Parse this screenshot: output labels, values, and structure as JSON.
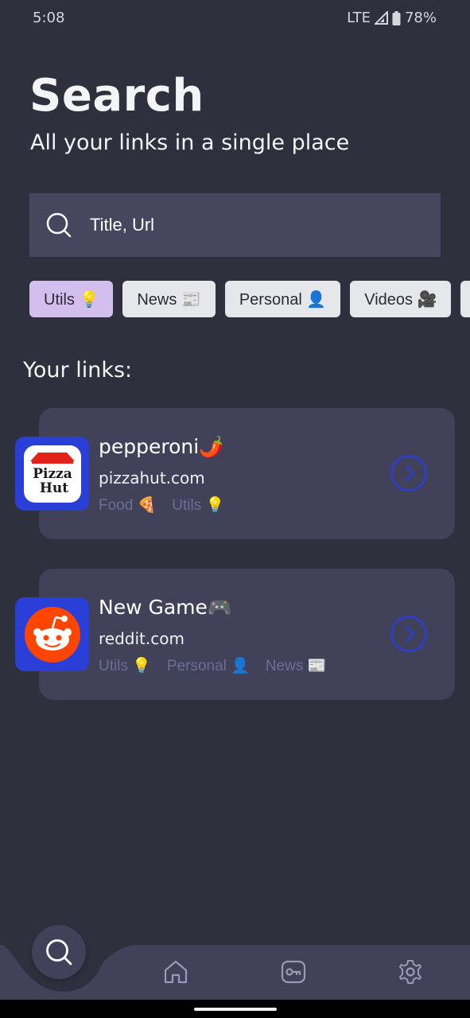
{
  "status_bar": {
    "time": "5:08",
    "network": "LTE",
    "battery": "78%"
  },
  "header": {
    "title": "Search",
    "subtitle": "All your links in a single place"
  },
  "search": {
    "placeholder": "Title, Url",
    "icon": "search-icon"
  },
  "chips": [
    {
      "label": "Utils 💡",
      "selected": true
    },
    {
      "label": "News 📰",
      "selected": false
    },
    {
      "label": "Personal 👤",
      "selected": false
    },
    {
      "label": "Videos 🎥",
      "selected": false
    }
  ],
  "links_section": {
    "title": "Your links:",
    "links": [
      {
        "title": "pepperoni🌶️",
        "url": "pizzahut.com",
        "tags": [
          "Food 🍕",
          "Utils 💡"
        ],
        "icon": "pizzahut-logo",
        "logo_text_top": "Pizza",
        "logo_text_bottom": "Hut"
      },
      {
        "title": "New Game🎮",
        "url": "reddit.com",
        "tags": [
          "Utils 💡",
          "Personal 👤",
          "News 📰"
        ],
        "icon": "reddit-logo"
      }
    ]
  },
  "bottom_nav": {
    "items": [
      "search-icon",
      "home-icon",
      "key-icon",
      "settings-icon"
    ],
    "active": "search-icon"
  },
  "colors": {
    "background": "#2e303e",
    "surface": "#42415a",
    "search_box": "#46465e",
    "chip": "#e6e7ea",
    "chip_active": "#d2bfee",
    "accent": "#2a3fd8",
    "tag_text": "#6a6f96",
    "reddit": "#ff4500"
  }
}
